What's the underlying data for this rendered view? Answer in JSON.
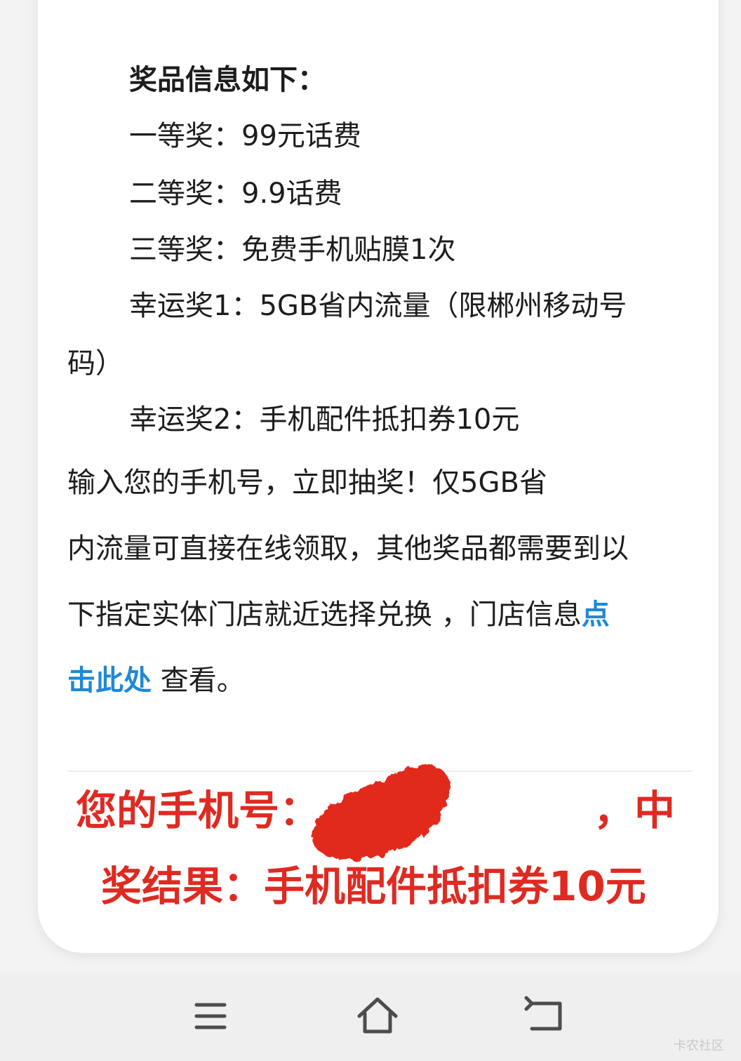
{
  "prize_info": {
    "heading": "奖品信息如下：",
    "items": [
      "一等奖：99元话费",
      "二等奖：9.9话费",
      "三等奖：免费手机贴膜1次",
      "幸运奖1：5GB省内流量（限郴州移动号",
      "码）",
      "幸运奖2：手机配件抵扣券10元"
    ]
  },
  "instructions": {
    "line1": "输入您的手机号，立即抽奖！仅5GB省",
    "line2": "内流量可直接在线领取，其他奖品都需要到以",
    "line3_prefix": "下指定实体门店就近选择兑换 ，门店信息",
    "link_part1": "点",
    "link_part2": "击此处",
    "line4_suffix": " 查看。"
  },
  "result": {
    "line1_prefix": "您的手机号：",
    "line1_suffix": "，中",
    "line2": "奖结果：手机配件抵扣券10元"
  },
  "navigation": {
    "menu_icon": "menu-icon",
    "home_icon": "home-icon",
    "back_icon": "back-icon"
  },
  "watermark": "卡农社区",
  "colors": {
    "link": "#1e88d6",
    "result": "#df2a22",
    "text": "#1d1d1d"
  }
}
